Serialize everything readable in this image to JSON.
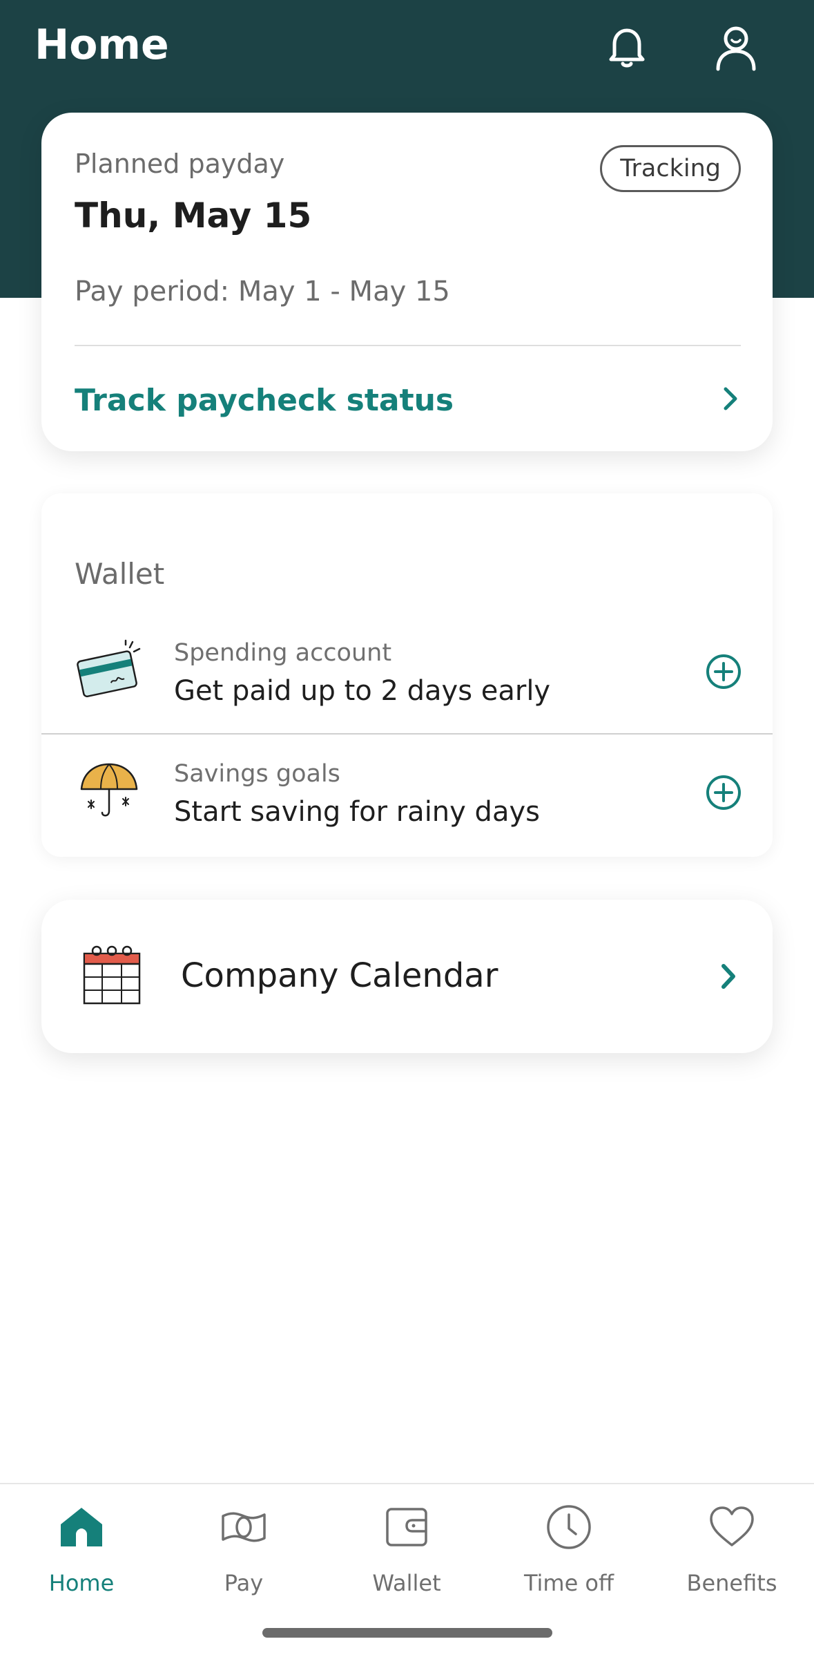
{
  "header": {
    "title": "Home",
    "icons": [
      "bell-icon",
      "profile-icon"
    ]
  },
  "payday": {
    "label": "Planned payday",
    "date": "Thu, May 15",
    "status_badge": "Tracking",
    "pay_period": "Pay period: May 1 - May 15",
    "track_link": "Track paycheck status"
  },
  "wallet": {
    "title": "Wallet",
    "items": [
      {
        "subtitle": "Spending account",
        "title": "Get paid up to 2 days early",
        "icon": "credit-card-icon"
      },
      {
        "subtitle": "Savings goals",
        "title": "Start saving for rainy days",
        "icon": "umbrella-icon"
      }
    ]
  },
  "calendar": {
    "label": "Company Calendar",
    "icon": "calendar-icon"
  },
  "tabbar": {
    "tabs": [
      {
        "label": "Home",
        "icon": "home-icon",
        "active": true
      },
      {
        "label": "Pay",
        "icon": "money-icon",
        "active": false
      },
      {
        "label": "Wallet",
        "icon": "wallet-icon",
        "active": false
      },
      {
        "label": "Time off",
        "icon": "clock-icon",
        "active": false
      },
      {
        "label": "Benefits",
        "icon": "heart-icon",
        "active": false
      }
    ]
  },
  "colors": {
    "header_bg": "#1c4245",
    "accent": "#15807a",
    "muted_text": "#6b6b6b"
  }
}
